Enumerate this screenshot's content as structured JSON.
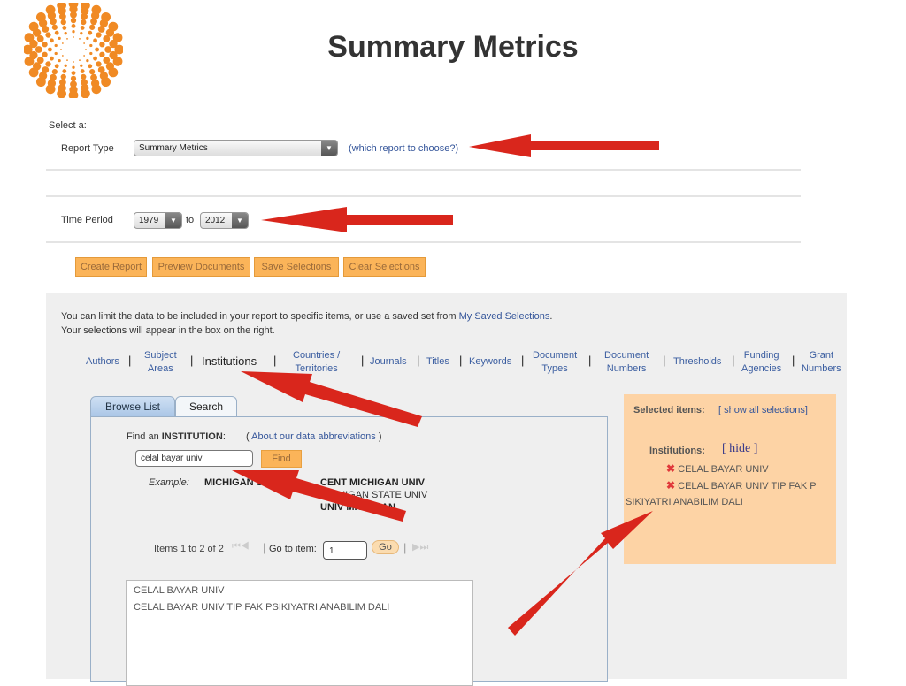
{
  "header": {
    "title": "Summary Metrics",
    "logo": "thomson-reuters-dot-logo",
    "brand_color": "#f08a24"
  },
  "form": {
    "select_label": "Select a:",
    "report_type_label": "Report Type",
    "report_type_value": "Summary Metrics",
    "report_help_link": "(which report to choose?)",
    "time_period_label": "Time Period",
    "year_from": "1979",
    "to_label": "to",
    "year_to": "2012"
  },
  "buttons": {
    "create": "Create Report",
    "preview": "Preview Documents",
    "save": "Save Selections",
    "clear": "Clear Selections"
  },
  "intro": {
    "line1": "You can limit the data to be included in your report to specific items, or use a saved set from ",
    "saved_link": "My Saved Selections",
    "period": ".",
    "line2": "Your selections will appear in the box on the right."
  },
  "nav": [
    {
      "label": "Authors"
    },
    {
      "label": "Subject\nAreas"
    },
    {
      "label": "Institutions"
    },
    {
      "label": "Countries /\nTerritories"
    },
    {
      "label": "Journals"
    },
    {
      "label": "Titles"
    },
    {
      "label": "Keywords"
    },
    {
      "label": "Document\nTypes"
    },
    {
      "label": "Document\nNumbers"
    },
    {
      "label": "Thresholds"
    },
    {
      "label": "Funding\nAgencies"
    },
    {
      "label": "Grant\nNumbers"
    }
  ],
  "tabs": {
    "browse": "Browse List",
    "search": "Search"
  },
  "search": {
    "find_prefix": "Find an ",
    "find_entity": "INSTITUTION",
    "find_colon": ":",
    "abbrev_open": "( ",
    "abbrev_link": "About our data abbreviations",
    "abbrev_close": " )",
    "input_value": "celal bayar univ",
    "find_button": "Find",
    "example_label": "Example:",
    "example_query": "MICHIGAN S",
    "example_results": [
      "CENT MICHIGAN UNIV",
      "MICHIGAN STATE UNIV",
      "UNIV MICHIGAN"
    ]
  },
  "pager": {
    "items": "Items 1 to 2 of 2",
    "goto_label": "Go to item:",
    "goto_value": "1",
    "go_button": "Go"
  },
  "results": [
    "CELAL BAYAR UNIV",
    "CELAL BAYAR UNIV TIP FAK PSIKIYATRI ANABILIM DALI"
  ],
  "selected": {
    "title": "Selected items:",
    "show_all": "[ show all selections]",
    "category": "Institutions:",
    "hide": "[ hide ]",
    "items": [
      "CELAL BAYAR UNIV",
      "CELAL BAYAR UNIV TIP FAK P"
    ],
    "overflow": "SIKIYATRI ANABILIM DALI"
  },
  "colors": {
    "arrow": "#d9261c",
    "button": "#fbb459",
    "selected_box": "#fdd3a5",
    "link": "#34559a"
  }
}
